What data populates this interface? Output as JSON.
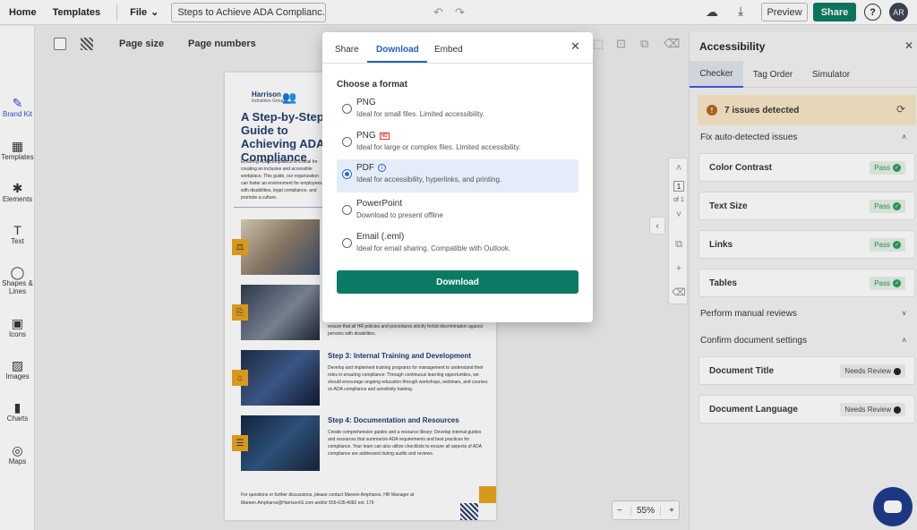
{
  "topbar": {
    "home": "Home",
    "templates": "Templates",
    "file": "File",
    "doc_title": "Steps to Achieve ADA Complianc...",
    "preview": "Preview",
    "share": "Share",
    "help": "?",
    "avatar": "AR"
  },
  "sidebar": {
    "items": [
      {
        "label": "Brand Kit",
        "icon": "✎"
      },
      {
        "label": "Templates",
        "icon": "▦"
      },
      {
        "label": "Elements",
        "icon": "✱"
      },
      {
        "label": "Text",
        "icon": "T"
      },
      {
        "label": "Shapes & Lines",
        "icon": "◯"
      },
      {
        "label": "Icons",
        "icon": "▣"
      },
      {
        "label": "Images",
        "icon": "▨"
      },
      {
        "label": "Charts",
        "icon": "▮"
      },
      {
        "label": "Maps",
        "icon": "◎"
      }
    ]
  },
  "subbar": {
    "page_size": "Page size",
    "page_numbers": "Page numbers"
  },
  "document": {
    "logo_name": "Harrison",
    "logo_sub": "Industries Group",
    "title": "A Step-by-Step Guide to Achieving ADA Compliance",
    "intro": "Ensuring ADA compliance is crucial for creating an inclusive and accessible workplace. This guide, our organization can foster an environment for employees with disabilities, legal compliance, and promote a culture.",
    "step2_body": "ensure that all HR policies and procedures strictly forbid discrimination against persons with disabilities.",
    "step3_title": "Step 3: Internal Training and Development",
    "step3_body": "Develop and implement training programs for management to understand their roles in ensuring compliance: Through continuous learning opportunities, we should encourage ongoing education through workshops, webinars, and courses on ADA compliance and sensitivity training.",
    "step4_title": "Step 4: Documentation and Resources",
    "step4_body": "Create comprehensive guides and a resource library: Develop internal guides and resources that summarize ADA requirements and best practices for compliance. Your team can also utilize checklists to ensure all aspects of ADA compliance are addressed during audits and reviews.",
    "footer": "For questions or further discussions, please contact Mareen Ampharos, HR Manager at Mareen.Ampharos@HarrisonIG.com and/or 555-635-4082 ext. 179"
  },
  "page_controls": {
    "current_page": "1",
    "of_pages": "of 1"
  },
  "zoom": {
    "minus": "−",
    "value": "55%",
    "plus": "+"
  },
  "panel": {
    "title": "Accessibility",
    "tabs": [
      "Checker",
      "Tag Order",
      "Simulator"
    ],
    "issues": "7 issues detected",
    "fix_section": "Fix auto-detected issues",
    "auto_checks": [
      {
        "label": "Color Contrast",
        "status": "Pass"
      },
      {
        "label": "Text Size",
        "status": "Pass"
      },
      {
        "label": "Links",
        "status": "Pass"
      },
      {
        "label": "Tables",
        "status": "Pass"
      }
    ],
    "manual_section": "Perform manual reviews",
    "confirm_section": "Confirm document settings",
    "settings": [
      {
        "label": "Document Title",
        "status": "Needs Review"
      },
      {
        "label": "Document Language",
        "status": "Needs Review"
      }
    ]
  },
  "modal": {
    "tabs": [
      "Share",
      "Download",
      "Embed"
    ],
    "heading": "Choose a format",
    "options": [
      {
        "name": "PNG",
        "desc": "Ideal for small files. Limited accessibility."
      },
      {
        "name": "PNG",
        "badge": "HD",
        "desc": "Ideal for large or complex files. Limited accessibility."
      },
      {
        "name": "PDF",
        "desc": "Ideal for accessibility, hyperlinks, and printing."
      },
      {
        "name": "PowerPoint",
        "desc": "Download to present offline"
      },
      {
        "name": "Email (.eml)",
        "desc": "Ideal for email sharing. Compatible with Outlook."
      }
    ],
    "selected": "PDF",
    "download_button": "Download"
  },
  "colors": {
    "primary_green": "#0b7a64",
    "accent_blue": "#1f5fcc",
    "warning_bg": "#f8e7c5",
    "navy": "#1f3b70"
  }
}
